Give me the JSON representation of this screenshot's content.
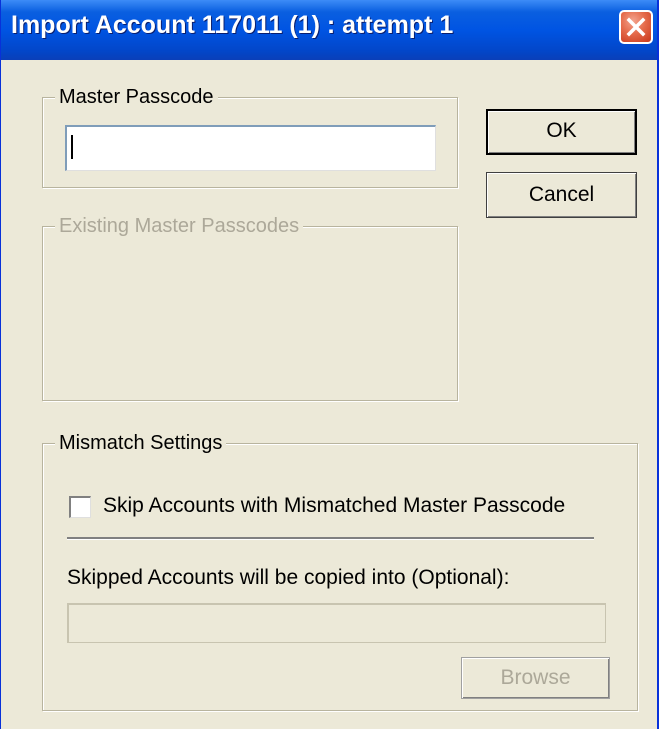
{
  "window": {
    "title": "Import Account 117011 (1) : attempt 1"
  },
  "master_passcode": {
    "legend": "Master Passcode",
    "value": ""
  },
  "existing_passcodes": {
    "legend": "Existing Master Passcodes"
  },
  "buttons": {
    "ok": "OK",
    "cancel": "Cancel",
    "browse": "Browse"
  },
  "mismatch": {
    "legend": "Mismatch Settings",
    "skip_label": "Skip Accounts with Mismatched Master Passcode",
    "skip_checked": false,
    "copy_label": "Skipped Accounts will be copied into (Optional):",
    "copy_path": ""
  },
  "icons": {
    "close": "close-icon"
  },
  "colors": {
    "titlebar": "#0054e3",
    "close_button": "#e56b4b",
    "window_bg": "#ece9d8",
    "disabled_text": "#aca899"
  }
}
